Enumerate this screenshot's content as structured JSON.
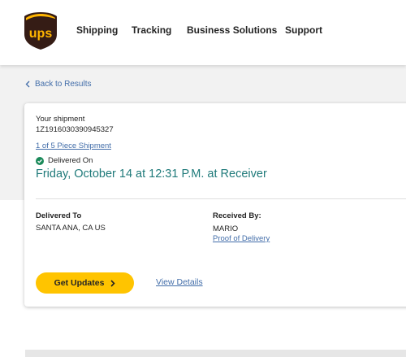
{
  "header": {
    "logo_text": "ups",
    "nav": [
      "Shipping",
      "Tracking",
      "Business Solutions",
      "Support"
    ]
  },
  "back_link": "Back to Results",
  "shipment": {
    "heading": "Your shipment",
    "tracking_number": "1Z1916030390945327",
    "piece_link": "1 of 5 Piece Shipment",
    "status_label": "Delivered On",
    "delivery_date": "Friday, October 14 at 12:31 P.M. at Receiver",
    "delivered_to_label": "Delivered To",
    "delivered_to_value": "SANTA ANA, CA US",
    "received_by_label": "Received By:",
    "received_by_value": "MARIO",
    "proof_link": "Proof of Delivery",
    "get_updates_label": "Get Updates",
    "view_details_label": "View Details"
  },
  "colors": {
    "ups_brown": "#351c15",
    "ups_gold": "#ffb500",
    "button_yellow": "#ffc400",
    "link_blue": "#426da9",
    "status_green": "#1b8a5a",
    "date_teal": "#1f7a7a"
  },
  "icons": {
    "back": "chevron-left-icon",
    "status": "check-circle-icon",
    "button": "chevron-right-icon"
  }
}
